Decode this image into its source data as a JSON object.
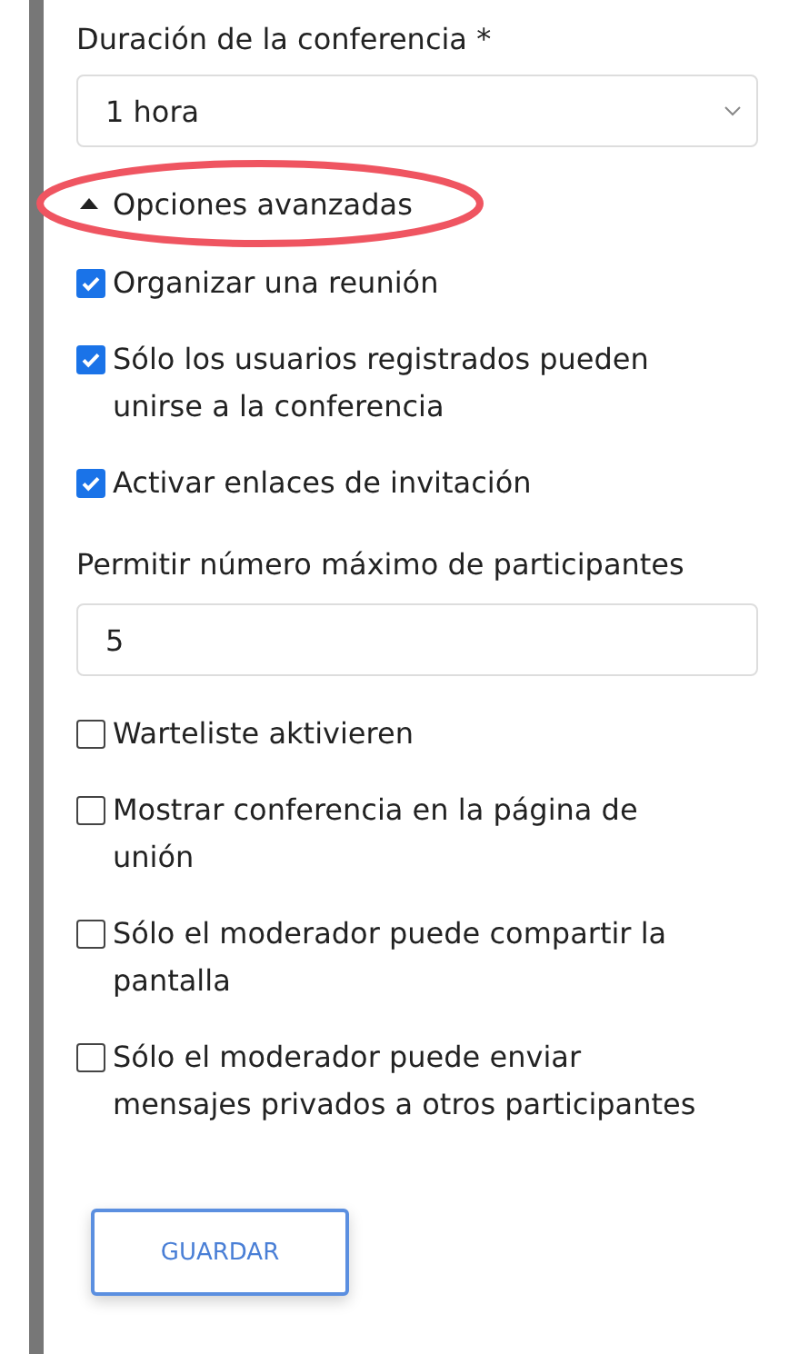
{
  "duration": {
    "label": "Duración de la conferencia *",
    "value": "1 hora"
  },
  "advanced": {
    "label": "Opciones avanzadas",
    "expanded": true,
    "highlighted": true
  },
  "options_top": [
    {
      "label": "Organizar una reunión",
      "checked": true
    },
    {
      "label": "Sólo los usuarios registrados pueden unirse a la conferencia",
      "checked": true
    },
    {
      "label": "Activar enlaces de invitación",
      "checked": true
    }
  ],
  "max_participants": {
    "label": "Permitir número máximo de participantes",
    "value": "5"
  },
  "options_bottom": [
    {
      "label": "Warteliste aktivieren",
      "checked": false
    },
    {
      "label": "Mostrar conferencia en la página de unión",
      "checked": false
    },
    {
      "label": "Sólo el moderador puede compartir la pantalla",
      "checked": false
    },
    {
      "label": "Sólo el moderador puede enviar mensajes privados a otros participantes",
      "checked": false
    }
  ],
  "save_button": "GUARDAR"
}
